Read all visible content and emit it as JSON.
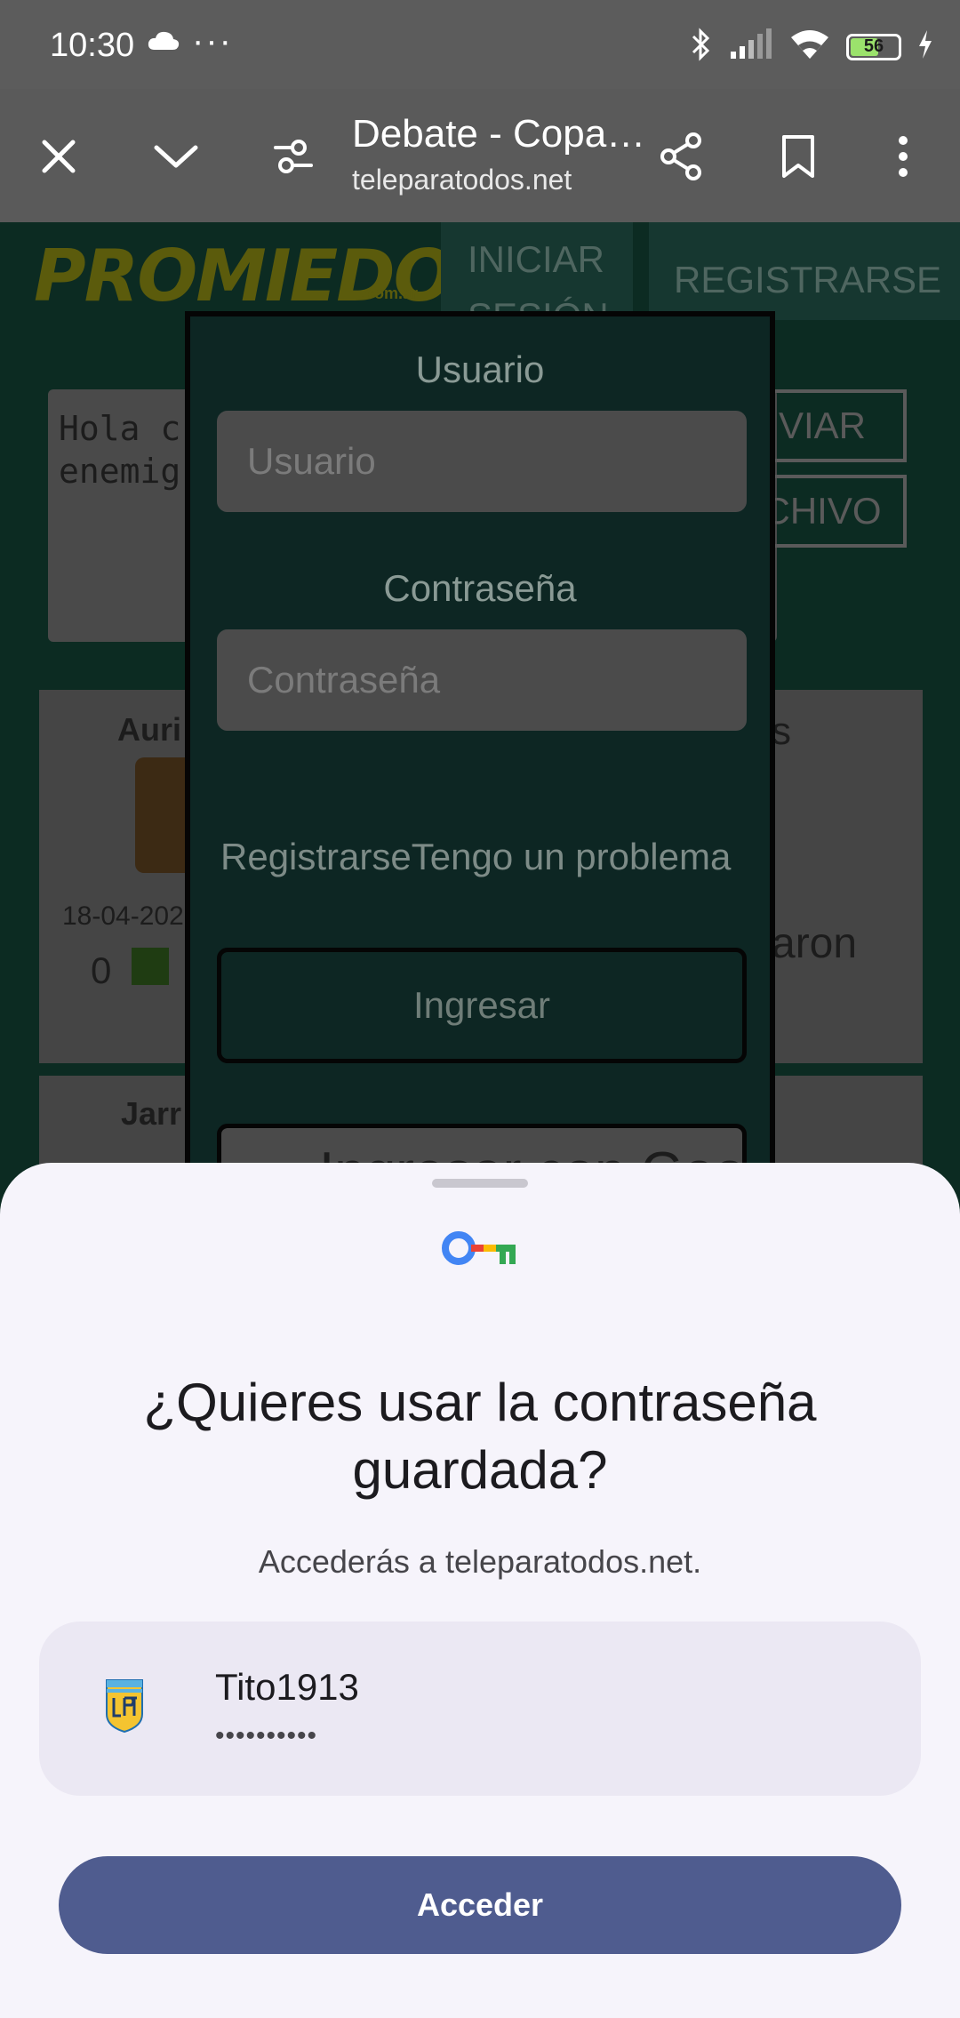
{
  "status_bar": {
    "time": "10:30",
    "more": "···",
    "battery": "56"
  },
  "browser": {
    "title": "Debate - Copa…",
    "url": "teleparatodos.net"
  },
  "site": {
    "logo": "PROMIEDOS",
    "logo_suffix": ".com.ar",
    "login_tab": "INICIAR SESIÓN",
    "register_tab": "REGISTRARSE",
    "comment_text": "Hola c\nenemig",
    "send_btn": "VIAR",
    "file_btn": "CHIVO",
    "card_left_name": "Auri",
    "card_left_date": "18-04-202",
    "card_left_count": "0",
    "card_right_text": "s",
    "card_right_text2": "aron",
    "card_left2_name": "Jarr"
  },
  "login_modal": {
    "user_label": "Usuario",
    "user_placeholder": "Usuario",
    "password_label": "Contraseña",
    "password_placeholder": "Contraseña",
    "register_link": "Registrarse",
    "problem_link": "Tengo un problema",
    "submit": "Ingresar",
    "google": "Ingresar con Goo"
  },
  "sheet": {
    "title": "¿Quieres usar la contraseña guardada?",
    "subtitle": "Accederás a teleparatodos.net.",
    "username": "Tito1913",
    "password_mask": "••••••••••",
    "accept_button": "Acceder"
  },
  "colors": {
    "accent": "#4f5c8f",
    "sheet_bg": "#f6f4fb",
    "card_bg": "#ebe8f3"
  }
}
